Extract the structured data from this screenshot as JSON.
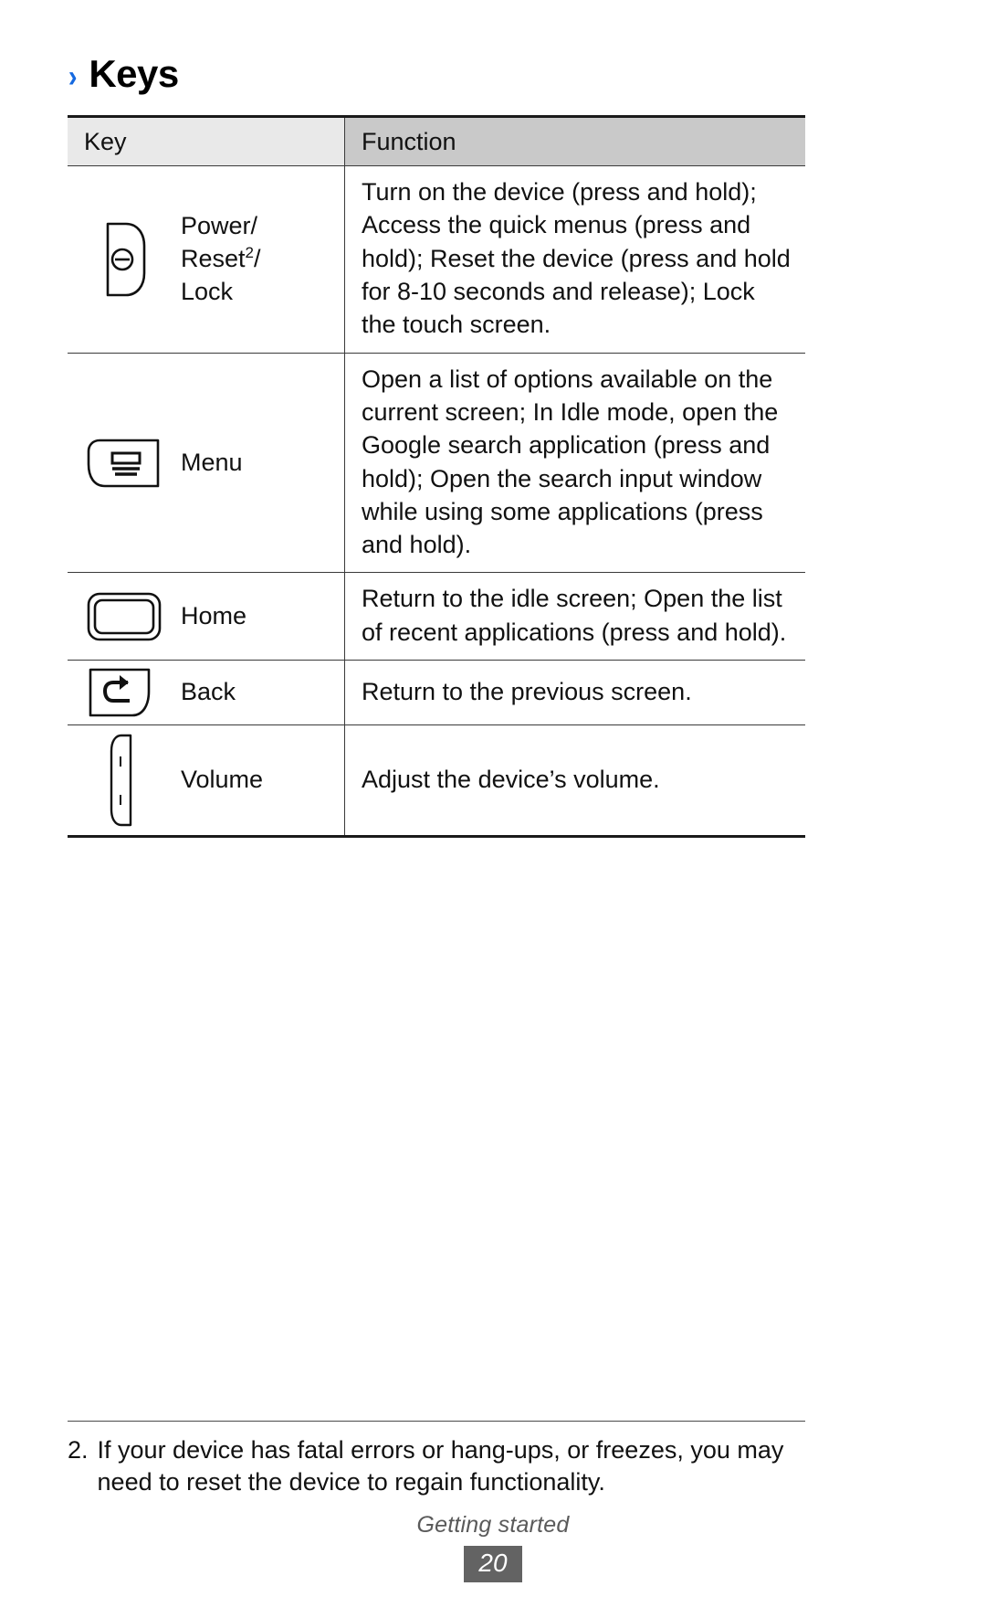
{
  "heading": {
    "chevron": "›",
    "title": "Keys"
  },
  "table": {
    "columns": {
      "key": "Key",
      "function": "Function"
    },
    "rows": [
      {
        "icon": "power-key-icon",
        "label_html": "Power/\nReset²/\nLock",
        "label_line1": "Power/",
        "label_line2": "Reset",
        "label_sup": "2",
        "label_line2_suffix": "/",
        "label_line3": "Lock",
        "function": "Turn on the device (press and hold); Access the quick menus (press and hold); Reset the device (press and hold for 8-10 seconds and release); Lock the touch screen."
      },
      {
        "icon": "menu-key-icon",
        "label": "Menu",
        "function": "Open a list of options available on the current screen; In Idle mode, open the Google search application (press and hold); Open the search input window while using some applications (press and hold)."
      },
      {
        "icon": "home-key-icon",
        "label": "Home",
        "function": "Return to the idle screen; Open the list of recent applications (press and hold)."
      },
      {
        "icon": "back-key-icon",
        "label": "Back",
        "function": "Return to the previous screen."
      },
      {
        "icon": "volume-key-icon",
        "label": "Volume",
        "function": "Adjust the device’s volume."
      }
    ]
  },
  "footnote": {
    "number": "2.",
    "text": "If your device has fatal errors or hang-ups, or freezes, you may need to reset the device to regain functionality."
  },
  "footer": {
    "section": "Getting started",
    "page_number": "20"
  },
  "colors": {
    "accent": "#1569e0",
    "header_key_bg": "#e9e9e9",
    "header_function_bg": "#c9c9c9",
    "rule": "#3a3a3a",
    "footer_badge_bg": "#636363",
    "text": "#111111"
  }
}
